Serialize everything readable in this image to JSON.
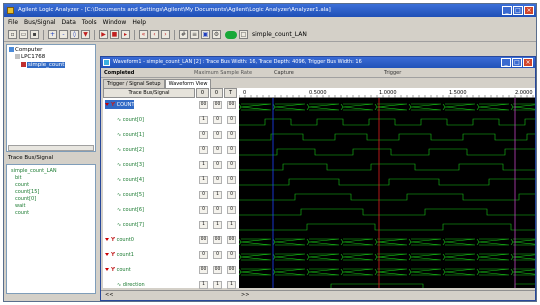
{
  "app": {
    "title": "Agilent Logic Analyzer - [C:\\Documents and Settings\\Agilent\\My Documents\\Agilent\\Logic Analyzer\\Analyzer1.ala]"
  },
  "menu": [
    "File",
    "Bus/Signal",
    "Data",
    "Tools",
    "Window",
    "Help"
  ],
  "toolbar": {
    "label": "simple_count_LAN"
  },
  "tree": {
    "root": "Computer",
    "child": "LPC1768",
    "selected": "simple_count"
  },
  "signals_panel": {
    "caption": "Trace Bus/Signal",
    "items": [
      "simple_count_LAN",
      "bit",
      "count",
      "count[15]",
      "count[0]",
      "wait",
      "count"
    ]
  },
  "window": {
    "title": "Waveform1 - simple_count_LAN [2] : Trace Bus Width: 16, Trace Depth: 4096, Trigger Bus Width: 16",
    "status": [
      "Completed",
      "Maximum Sample Rate",
      "Capture",
      "Trigger"
    ],
    "tabs": [
      "Trigger / Signal Setup",
      "Waveform View"
    ],
    "active_tab": 1,
    "table_header": {
      "signal": "Trace Bus/Signal",
      "c1": "0",
      "c2": "0",
      "c3": "T"
    }
  },
  "rows": [
    {
      "name": "COUNT",
      "v1": "00",
      "v2": "00",
      "v3": "00",
      "bus": true,
      "selected": true
    },
    {
      "name": "count[0]",
      "v1": "1",
      "v2": "0",
      "v3": "0",
      "bus": false,
      "selected": false
    },
    {
      "name": "count[1]",
      "v1": "0",
      "v2": "0",
      "v3": "0",
      "bus": false,
      "selected": false
    },
    {
      "name": "count[2]",
      "v1": "0",
      "v2": "0",
      "v3": "0",
      "bus": false,
      "selected": false
    },
    {
      "name": "count[3]",
      "v1": "1",
      "v2": "0",
      "v3": "0",
      "bus": false,
      "selected": false
    },
    {
      "name": "count[4]",
      "v1": "1",
      "v2": "0",
      "v3": "0",
      "bus": false,
      "selected": false
    },
    {
      "name": "count[5]",
      "v1": "0",
      "v2": "1",
      "v3": "0",
      "bus": false,
      "selected": false
    },
    {
      "name": "count[6]",
      "v1": "0",
      "v2": "0",
      "v3": "0",
      "bus": false,
      "selected": false
    },
    {
      "name": "count[7]",
      "v1": "1",
      "v2": "1",
      "v3": "1",
      "bus": false,
      "selected": false
    },
    {
      "name": "count0",
      "v1": "00",
      "v2": "00",
      "v3": "00",
      "bus": true,
      "selected": false
    },
    {
      "name": "count1",
      "v1": "0",
      "v2": "0",
      "v3": "0",
      "bus": true,
      "selected": false
    },
    {
      "name": "count",
      "v1": "00",
      "v2": "00",
      "v3": "00",
      "bus": true,
      "selected": false
    },
    {
      "name": "direction",
      "v1": "1",
      "v2": "1",
      "v3": "1",
      "bus": false,
      "selected": false
    }
  ],
  "timeline": {
    "ticks": [
      "0",
      "0.5000",
      "1.0000",
      "1.5000",
      "2.0000"
    ]
  },
  "bottom": {
    "left": "<<",
    "right": ">>"
  }
}
